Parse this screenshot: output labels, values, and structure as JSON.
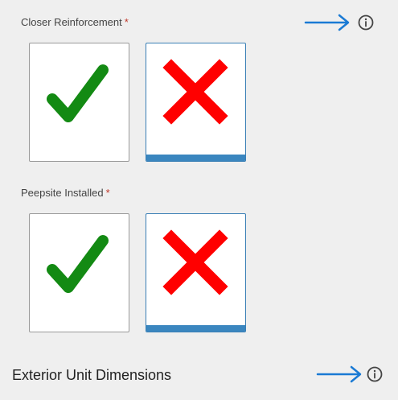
{
  "fields": [
    {
      "label": "Closer Reinforcement",
      "required_mark": "*",
      "options": [
        {
          "name": "yes",
          "icon": "green-checkmark-icon",
          "selected": false
        },
        {
          "name": "no",
          "icon": "red-x-icon",
          "selected": true
        }
      ]
    },
    {
      "label": "Peepsite Installed",
      "required_mark": "*",
      "options": [
        {
          "name": "yes",
          "icon": "green-checkmark-icon",
          "selected": false
        },
        {
          "name": "no",
          "icon": "red-x-icon",
          "selected": true
        }
      ]
    }
  ],
  "section": {
    "title": "Exterior Unit Dimensions"
  },
  "icons": {
    "info": "info-circle-icon",
    "arrow": "right-arrow-icon"
  },
  "colors": {
    "check_green": "#138a13",
    "x_red": "#ff0000",
    "selected_bar": "#3a86bf",
    "arrow_blue": "#1a7ad4",
    "required_red": "#c0392b"
  }
}
